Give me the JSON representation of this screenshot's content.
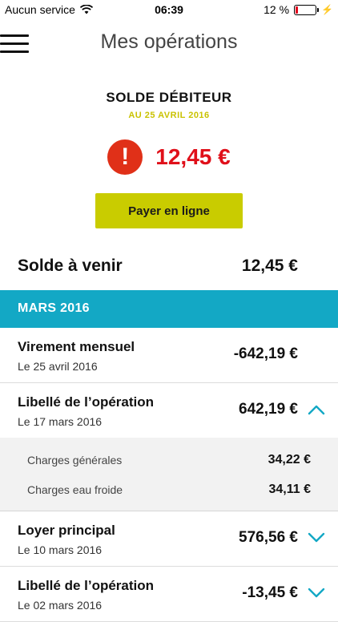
{
  "status_bar": {
    "carrier": "Aucun service",
    "time": "06:39",
    "battery_percent": "12 %",
    "battery_level": 0.12
  },
  "header": {
    "title": "Mes opérations"
  },
  "balance": {
    "label": "SOLDE DÉBITEUR",
    "date": "AU 25 AVRIL 2016",
    "amount": "12,45 €",
    "alert_symbol": "!",
    "pay_button_label": "Payer en ligne"
  },
  "upcoming": {
    "label": "Solde à venir",
    "amount": "12,45 €"
  },
  "month": {
    "label": "MARS 2016"
  },
  "operations": [
    {
      "title": "Virement mensuel",
      "date": "Le 25 avril 2016",
      "amount": "-642,19 €",
      "chevron": "none"
    },
    {
      "title": "Libellé de l’opération",
      "date": "Le 17 mars 2016",
      "amount": "642,19 €",
      "chevron": "up"
    },
    {
      "title": "Loyer principal",
      "date": "Le 10 mars 2016",
      "amount": "576,56 €",
      "chevron": "down"
    },
    {
      "title": "Libellé de l’opération",
      "date": "Le 02 mars 2016",
      "amount": "-13,45 €",
      "chevron": "down"
    }
  ],
  "operation_details": [
    {
      "label": "Charges générales",
      "amount": "34,22 €"
    },
    {
      "label": "Charges eau froide",
      "amount": "34,11 €"
    }
  ],
  "colors": {
    "accent_teal": "#13a8c5",
    "accent_yellow": "#c9cc00",
    "alert_red": "#e0101a"
  }
}
